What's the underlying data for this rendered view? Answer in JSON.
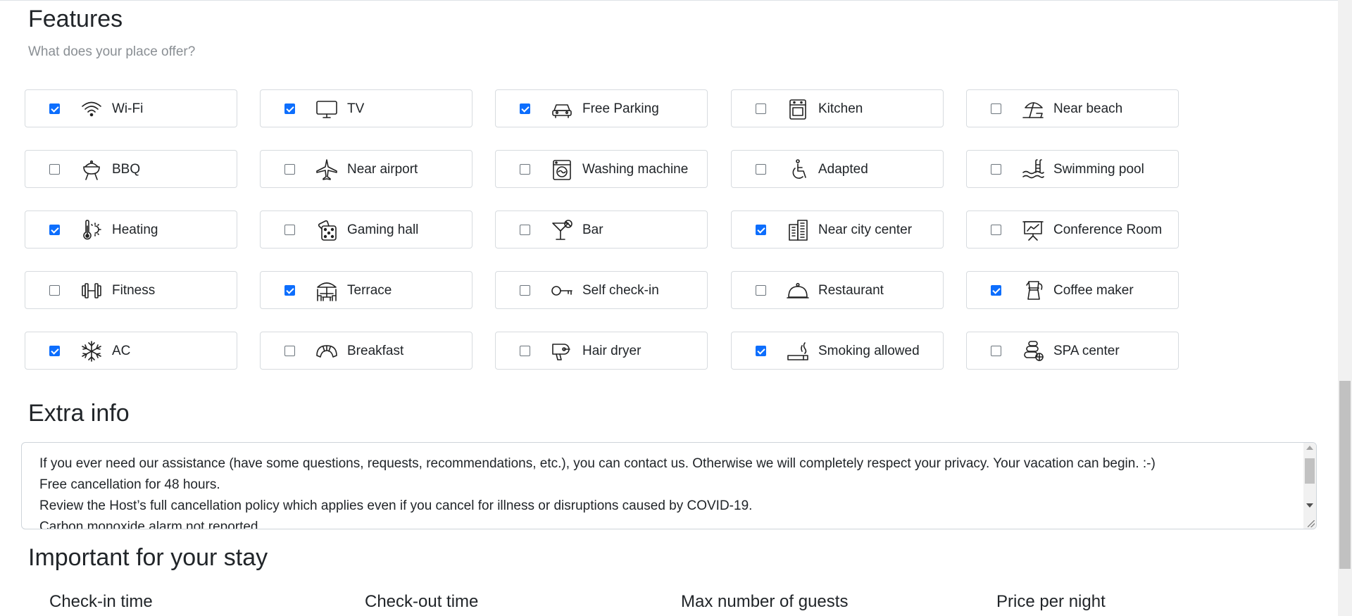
{
  "features_section": {
    "title": "Features",
    "subtitle": "What does your place offer?",
    "items": [
      {
        "label": "Wi-Fi",
        "checked": true,
        "icon": "wifi-icon"
      },
      {
        "label": "TV",
        "checked": true,
        "icon": "tv-icon"
      },
      {
        "label": "Free Parking",
        "checked": true,
        "icon": "car-icon"
      },
      {
        "label": "Kitchen",
        "checked": false,
        "icon": "stove-icon"
      },
      {
        "label": "Near beach",
        "checked": false,
        "icon": "beach-umbrella-icon"
      },
      {
        "label": "BBQ",
        "checked": false,
        "icon": "grill-icon"
      },
      {
        "label": "Near airport",
        "checked": false,
        "icon": "airplane-icon"
      },
      {
        "label": "Washing machine",
        "checked": false,
        "icon": "washing-machine-icon"
      },
      {
        "label": "Adapted",
        "checked": false,
        "icon": "wheelchair-icon"
      },
      {
        "label": "Swimming pool",
        "checked": false,
        "icon": "pool-icon"
      },
      {
        "label": "Heating",
        "checked": true,
        "icon": "thermometer-icon"
      },
      {
        "label": "Gaming hall",
        "checked": false,
        "icon": "dice-icon"
      },
      {
        "label": "Bar",
        "checked": false,
        "icon": "cocktail-icon"
      },
      {
        "label": "Near city center",
        "checked": true,
        "icon": "building-icon"
      },
      {
        "label": "Conference Room",
        "checked": false,
        "icon": "presentation-icon"
      },
      {
        "label": "Fitness",
        "checked": false,
        "icon": "dumbbell-icon"
      },
      {
        "label": "Terrace",
        "checked": true,
        "icon": "terrace-umbrella-icon"
      },
      {
        "label": "Self check-in",
        "checked": false,
        "icon": "key-icon"
      },
      {
        "label": "Restaurant",
        "checked": false,
        "icon": "cloche-icon"
      },
      {
        "label": "Coffee maker",
        "checked": true,
        "icon": "moka-pot-icon"
      },
      {
        "label": "AC",
        "checked": true,
        "icon": "snowflake-icon"
      },
      {
        "label": "Breakfast",
        "checked": false,
        "icon": "croissant-icon"
      },
      {
        "label": "Hair dryer",
        "checked": false,
        "icon": "hair-dryer-icon"
      },
      {
        "label": "Smoking allowed",
        "checked": true,
        "icon": "cigarette-icon"
      },
      {
        "label": "SPA center",
        "checked": false,
        "icon": "spa-stones-icon"
      }
    ]
  },
  "extra_info": {
    "title": "Extra info",
    "lines": [
      "If you ever need our assistance (have some questions, requests, recommendations, etc.), you can contact us. Otherwise we will completely respect your privacy. Your vacation can begin. :-)",
      "Free cancellation for 48 hours.",
      "Review the Host’s full cancellation policy which applies even if you cancel for illness or disruptions caused by COVID-19.",
      "Carbon monoxide alarm not reported"
    ]
  },
  "important": {
    "title": "Important for your stay",
    "fields": [
      "Check-in time",
      "Check-out time",
      "Max number of guests",
      "Price per night"
    ]
  },
  "colors": {
    "accent": "#0d6efd",
    "border": "#d7dbdf",
    "muted": "#8a8f94"
  }
}
